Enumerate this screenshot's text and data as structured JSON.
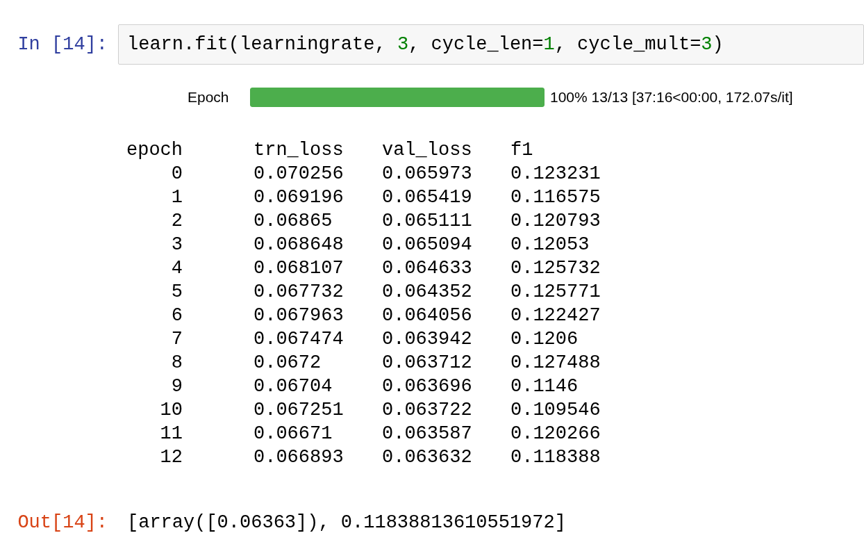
{
  "input_cell": {
    "prompt": "In [14]:",
    "code": [
      {
        "kind": "text",
        "text": "learn.fit(learningrate, "
      },
      {
        "kind": "number",
        "text": "3"
      },
      {
        "kind": "text",
        "text": ", cycle_len="
      },
      {
        "kind": "number",
        "text": "1"
      },
      {
        "kind": "text",
        "text": ", cycle_mult="
      },
      {
        "kind": "number",
        "text": "3"
      },
      {
        "kind": "text",
        "text": ")"
      }
    ]
  },
  "progress": {
    "label": "Epoch",
    "level": 1,
    "status": "100% 13/13 [37:16<00:00, 172.07s/it]"
  },
  "table": {
    "columns": [
      "epoch",
      "trn_loss",
      "val_loss",
      "f1"
    ],
    "rows": [
      [
        "0",
        "0.070256",
        "0.065973",
        "0.123231"
      ],
      [
        "1",
        "0.069196",
        "0.065419",
        "0.116575"
      ],
      [
        "2",
        "0.06865",
        "0.065111",
        "0.120793"
      ],
      [
        "3",
        "0.068648",
        "0.065094",
        "0.12053"
      ],
      [
        "4",
        "0.068107",
        "0.064633",
        "0.125732"
      ],
      [
        "5",
        "0.067732",
        "0.064352",
        "0.125771"
      ],
      [
        "6",
        "0.067963",
        "0.064056",
        "0.122427"
      ],
      [
        "7",
        "0.067474",
        "0.063942",
        "0.1206"
      ],
      [
        "8",
        "0.0672",
        "0.063712",
        "0.127488"
      ],
      [
        "9",
        "0.06704",
        "0.063696",
        "0.1146"
      ],
      [
        "10",
        "0.067251",
        "0.063722",
        "0.109546"
      ],
      [
        "11",
        "0.06671",
        "0.063587",
        "0.120266"
      ],
      [
        "12",
        "0.066893",
        "0.063632",
        "0.118388"
      ]
    ]
  },
  "output_cell": {
    "prompt": "Out[14]:",
    "text": "[array([0.06363]), 0.11838813610551972]"
  }
}
